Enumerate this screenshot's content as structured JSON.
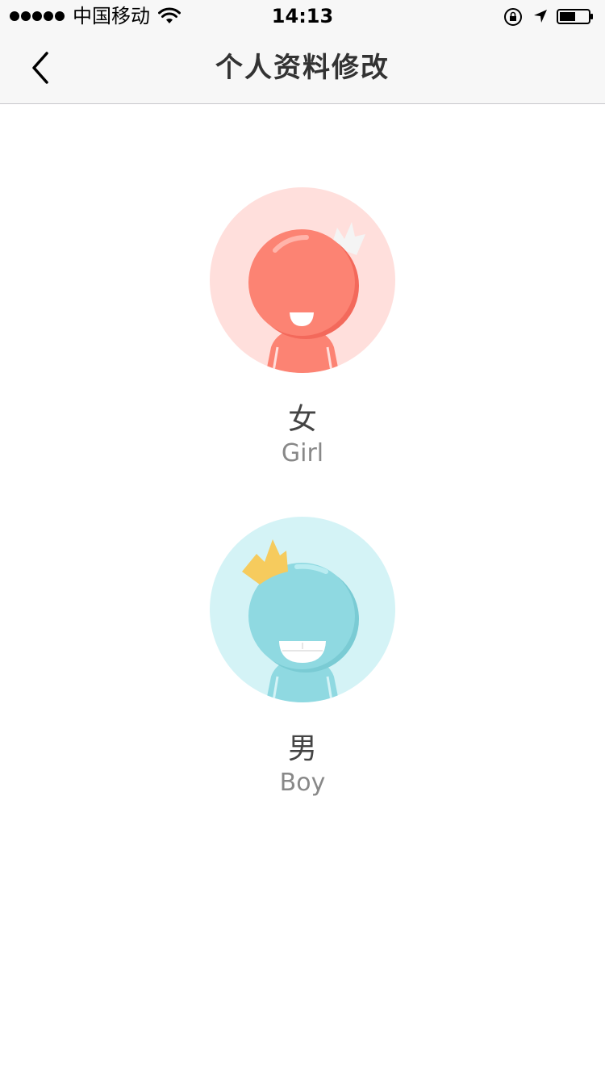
{
  "status_bar": {
    "carrier": "中国移动",
    "time": "14:13",
    "signal_bars": 5,
    "battery_level": 0.5
  },
  "nav": {
    "title": "个人资料修改",
    "back_icon": "chevron-left-icon"
  },
  "options": [
    {
      "cn": "女",
      "en": "Girl",
      "avatar": "girl-avatar-icon"
    },
    {
      "cn": "男",
      "en": "Boy",
      "avatar": "boy-avatar-icon"
    }
  ],
  "colors": {
    "girl_bg": "#ffdfdc",
    "girl_body": "#fc8373",
    "boy_bg": "#d4f3f6",
    "boy_body": "#8fd9e1",
    "crown": "#f6cb5d",
    "title_text": "#333333"
  }
}
